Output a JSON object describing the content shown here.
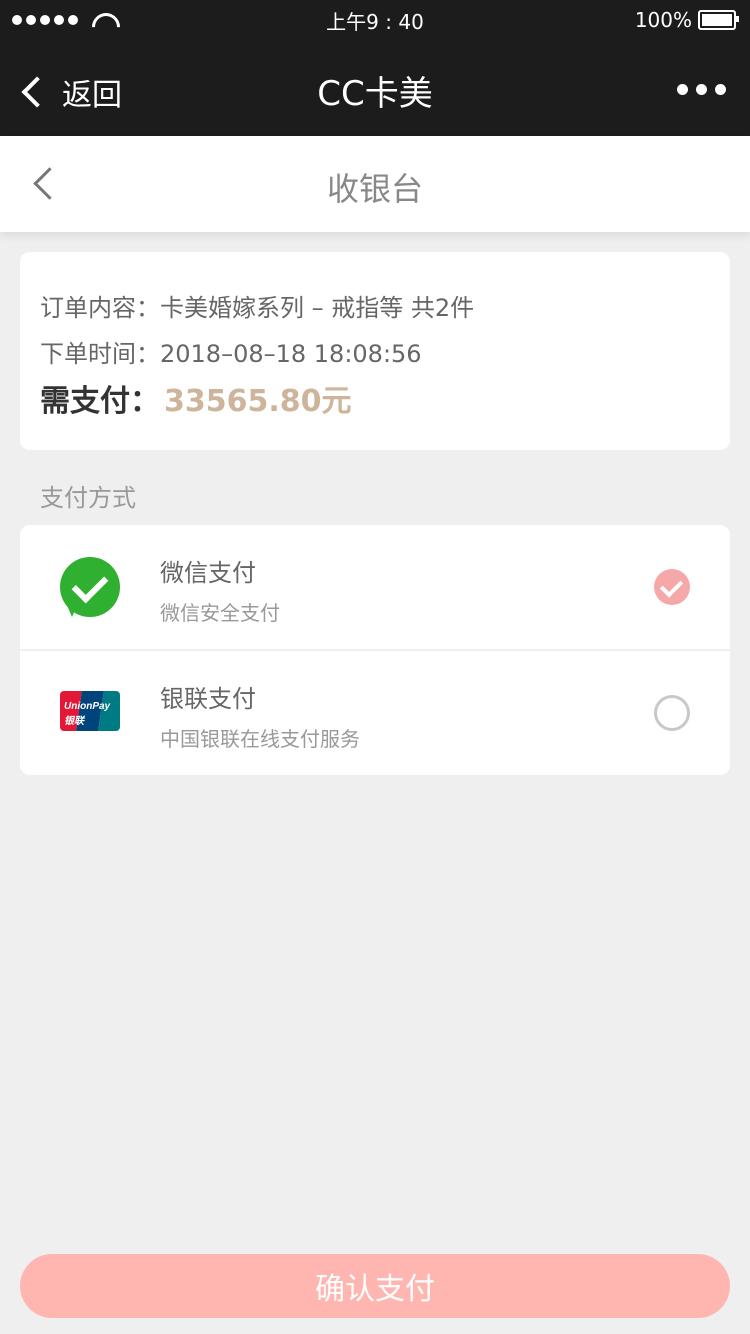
{
  "status_bar": {
    "time": "上午9 : 40",
    "battery": "100%"
  },
  "nav": {
    "back_label": "返回",
    "title": "CC卡美"
  },
  "header": {
    "title": "收银台"
  },
  "order": {
    "content": "订单内容：卡美婚嫁系列 – 戒指等 共2件",
    "time": "下单时间：2018–08–18 18:08:56",
    "pay_label": "需支付：",
    "amount": "33565.80元",
    "amount_color": "#CDB49B"
  },
  "payment": {
    "section_label": "支付方式",
    "methods": [
      {
        "name": "微信支付",
        "desc": "微信安全支付",
        "icon": "wechat-pay-icon",
        "selected": true
      },
      {
        "name": "银联支付",
        "desc": "中国银联在线支付服务",
        "icon": "unionpay-icon",
        "selected": false,
        "icon_text": "UnionPay 银联"
      }
    ]
  },
  "confirm": {
    "label": "确认支付",
    "color": "#ffb6b1"
  }
}
